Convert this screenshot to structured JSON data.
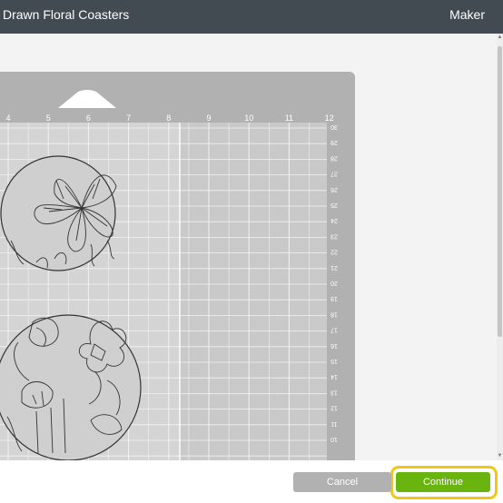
{
  "header": {
    "title": "Drawn Floral Coasters",
    "machine": "Maker"
  },
  "mat": {
    "top_ruler": [
      "4",
      "5",
      "6",
      "7",
      "8",
      "9",
      "10",
      "11",
      "12"
    ],
    "side_ruler": [
      "30",
      "29",
      "28",
      "27",
      "26",
      "25",
      "24",
      "23",
      "22",
      "21",
      "20",
      "19",
      "18",
      "17",
      "16",
      "15",
      "14",
      "13",
      "12",
      "11",
      "10"
    ],
    "coasters": [
      {
        "name": "flower-coaster-top"
      },
      {
        "name": "flower-coaster-bottom"
      }
    ]
  },
  "footer": {
    "cancel_label": "Cancel",
    "continue_label": "Continue"
  },
  "colors": {
    "titlebar": "#424a52",
    "mat": "#b1b1b1",
    "continue": "#69b40f",
    "highlight": "#f3c613"
  }
}
